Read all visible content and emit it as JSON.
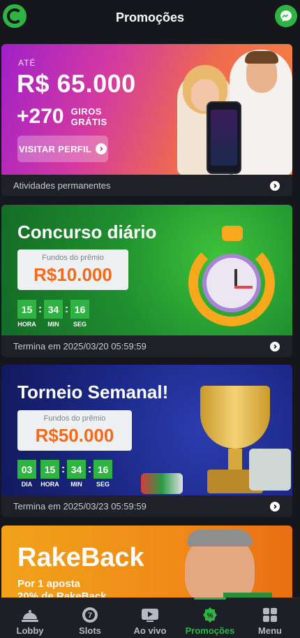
{
  "header": {
    "title": "Promoções",
    "logo_icon": "gigabet-logo-icon",
    "messenger_icon": "messenger-icon",
    "accent_color": "#2fb444"
  },
  "promos": [
    {
      "prefix": "ATÉ",
      "amount": "R$ 65.000",
      "spins": "+270",
      "spins_line1": "GIROS",
      "spins_line2": "GRÁTIS",
      "button": "VISITAR PERFIL",
      "footer": "Atividades permanentes"
    },
    {
      "title": "Concurso diário",
      "fund_label": "Fundos do prêmio",
      "fund_value": "R$10.000",
      "timer": [
        {
          "value": "15",
          "label": "HORA"
        },
        {
          "value": "34",
          "label": "MIN"
        },
        {
          "value": "16",
          "label": "SEG"
        }
      ],
      "footer": "Termina em 2025/03/20 05:59:59"
    },
    {
      "title": "Torneio Semanal!",
      "fund_label": "Fundos do prêmio",
      "fund_value": "R$50.000",
      "timer": [
        {
          "value": "03",
          "label": "DIA"
        },
        {
          "value": "15",
          "label": "HORA"
        },
        {
          "value": "34",
          "label": "MIN"
        },
        {
          "value": "16",
          "label": "SEG"
        }
      ],
      "footer": "Termina em 2025/03/23 05:59:59"
    },
    {
      "title": "RakeBack",
      "sub_line1": "Por 1 aposta",
      "sub_line2": "20% de RakeBack"
    }
  ],
  "nav": {
    "items": [
      {
        "label": "Lobby",
        "icon": "bell-icon"
      },
      {
        "label": "Slots",
        "icon": "slot-icon"
      },
      {
        "label": "Ao vivo",
        "icon": "live-tv-icon"
      },
      {
        "label": "Promoções",
        "icon": "promo-icon"
      },
      {
        "label": "Menu",
        "icon": "grid-menu-icon"
      }
    ],
    "active": "Promoções"
  }
}
